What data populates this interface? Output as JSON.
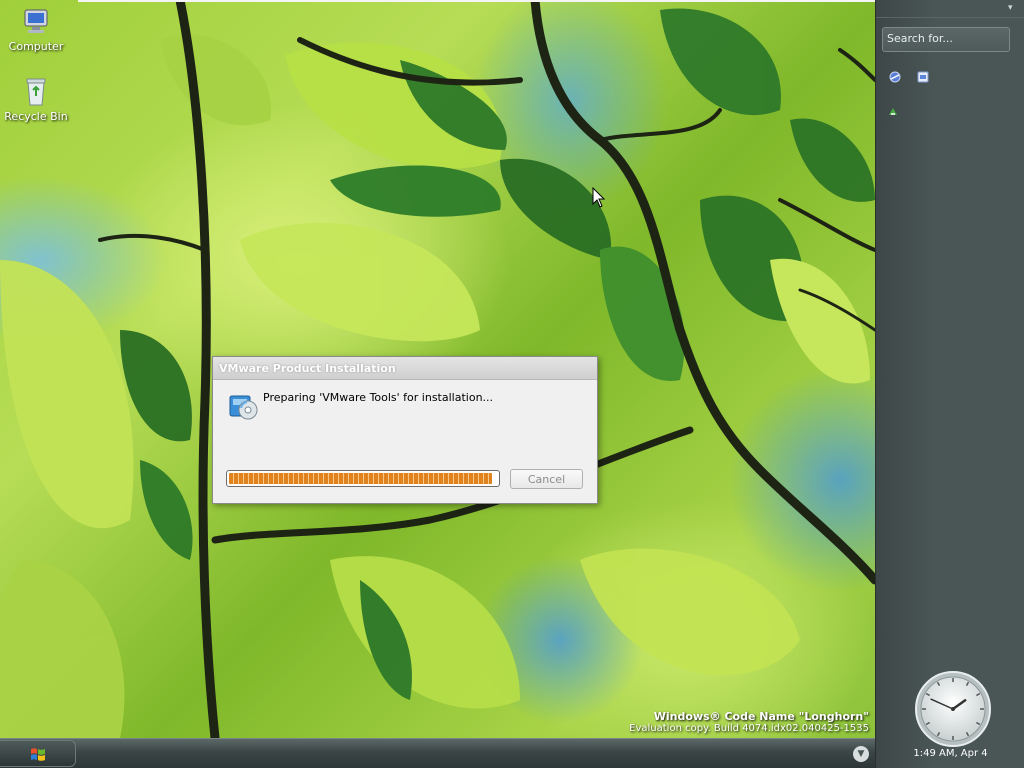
{
  "desktop": {
    "icons": [
      {
        "label": "Computer",
        "icon": "computer-icon"
      },
      {
        "label": "Recycle Bin",
        "icon": "recycle-bin-icon"
      }
    ],
    "watermark": {
      "line1": "Windows® Code Name \"Longhorn\"",
      "line2": "Evaluation copy. Build 4074.idx02.040425-1535"
    }
  },
  "dialog": {
    "title": "VMware Product Installation",
    "message": "Preparing 'VMware Tools' for installation...",
    "progress_fraction": 0.98,
    "cancel_label": "Cancel",
    "cancel_enabled": false
  },
  "sidebar": {
    "search_placeholder": "Search for...",
    "tiles": [
      "network-icon",
      "document-icon",
      "recycle-arrow-icon"
    ],
    "clock": {
      "label": "1:49 AM, Apr 4",
      "hour": 1,
      "minute": 49
    }
  },
  "taskbar": {
    "start_icon": "windows-logo-icon",
    "overflow_icon": "chevron-down-icon"
  },
  "colors": {
    "progress": "#e0831e",
    "sidebar": "#4a5656",
    "taskbar": "#3b4545"
  }
}
